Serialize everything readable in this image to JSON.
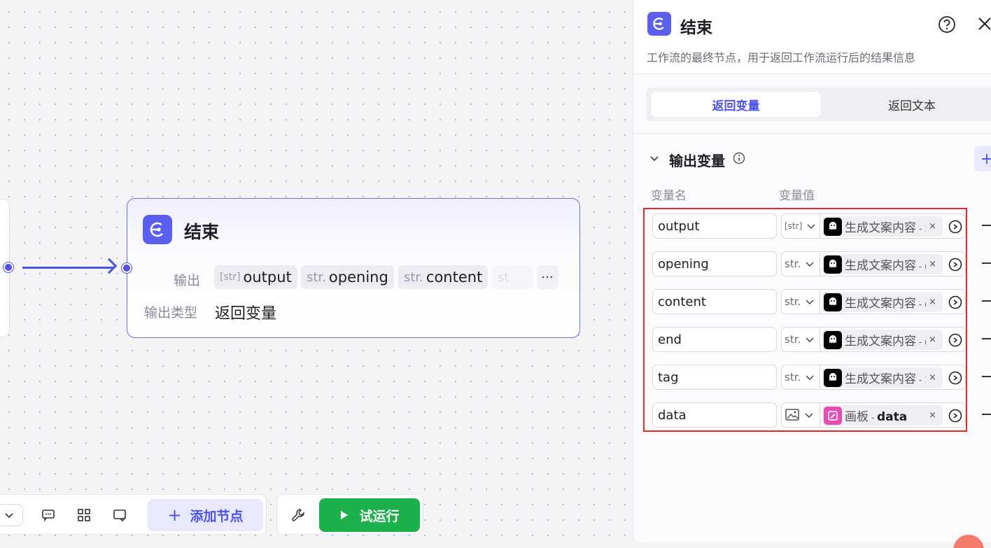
{
  "node": {
    "title": "结束",
    "output_label": "输出",
    "output_type_label": "输出类型",
    "output_type_value": "返回变量",
    "outputs": [
      {
        "type": "[str]",
        "name": "output"
      },
      {
        "type": "str.",
        "name": "opening"
      },
      {
        "type": "str.",
        "name": "content"
      },
      {
        "type": "st",
        "name": ""
      }
    ],
    "more_label": "···"
  },
  "toolbar": {
    "add_node_label": "添加节点",
    "run_label": "试运行"
  },
  "panel": {
    "title": "结束",
    "description": "工作流的最终节点，用于返回工作流运行后的结果信息",
    "tabs": [
      {
        "label": "返回变量",
        "active": true
      },
      {
        "label": "返回文本",
        "active": false
      }
    ],
    "section_title": "输出变量",
    "col_name": "变量名",
    "col_value": "变量值",
    "variables": [
      {
        "name": "output",
        "type": "[str]",
        "source": "生成文案内容",
        "suffix": " - 1",
        "source_icon": "ghost-icon"
      },
      {
        "name": "opening",
        "type": "str.",
        "source": "生成文案内容",
        "suffix": " - (",
        "source_icon": "ghost-icon"
      },
      {
        "name": "content",
        "type": "str.",
        "source": "生成文案内容",
        "suffix": " - (",
        "source_icon": "ghost-icon"
      },
      {
        "name": "end",
        "type": "str.",
        "source": "生成文案内容",
        "suffix": " - (",
        "source_icon": "ghost-icon"
      },
      {
        "name": "tag",
        "type": "str.",
        "source": "生成文案内容",
        "suffix": " - 1",
        "source_icon": "ghost-icon"
      },
      {
        "name": "data",
        "type": "image",
        "source": "画板",
        "suffix": " - ",
        "field": "data",
        "source_icon": "canvas-board-icon"
      }
    ]
  },
  "colors": {
    "accent": "#4d53e8",
    "run_green": "#1cb14a",
    "highlight_red": "#e8272b"
  }
}
